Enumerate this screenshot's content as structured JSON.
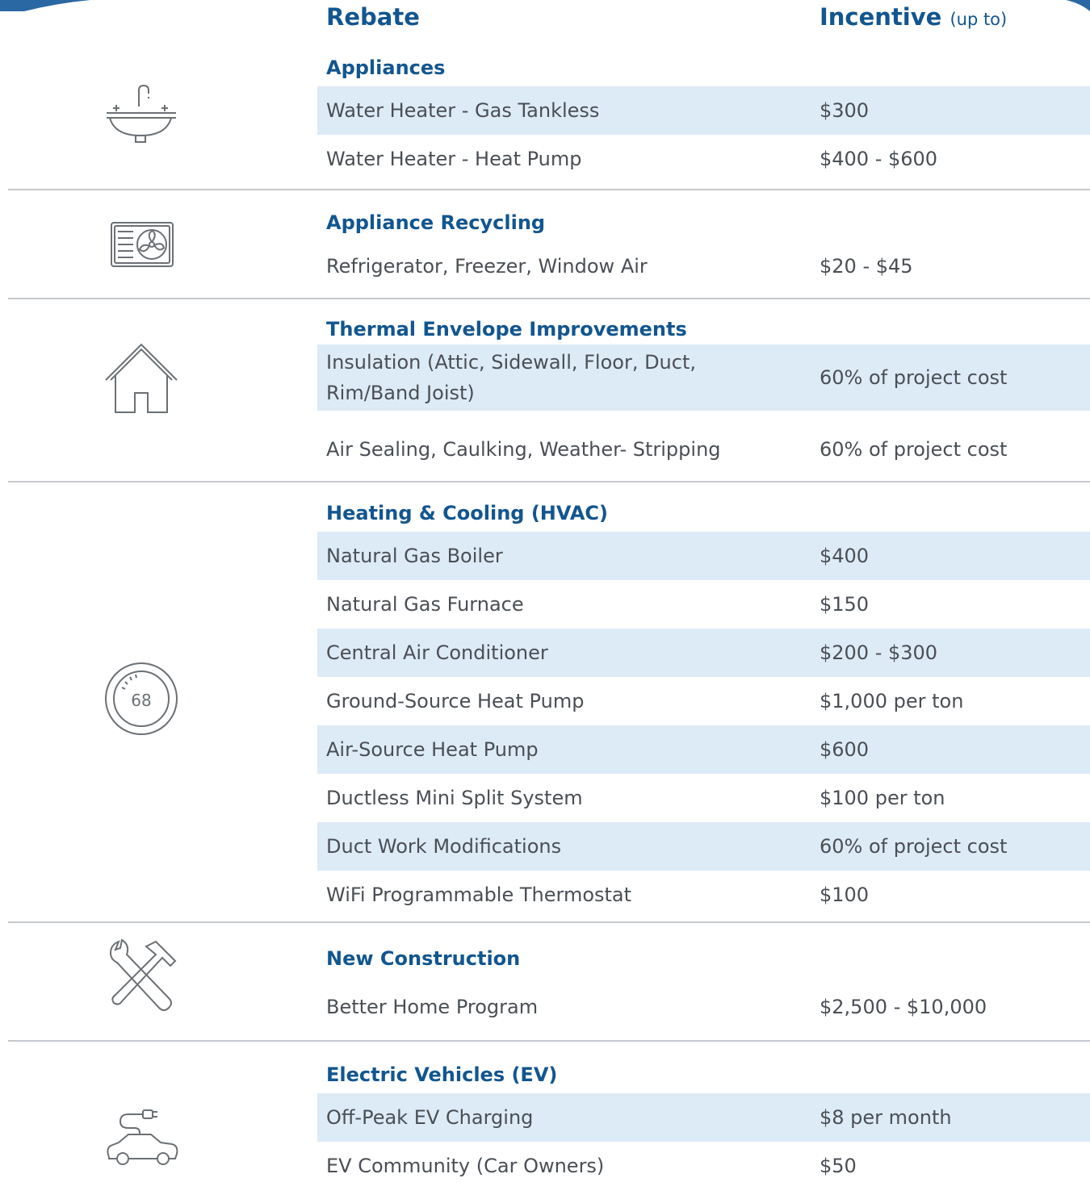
{
  "header": {
    "rebate": "Rebate",
    "incentive": "Incentive",
    "up_to": "(up to)"
  },
  "colors": {
    "accent": "#12568f",
    "row_shade": "#ddebf7",
    "divider": "#c5c9cd",
    "text": "#4a4f55"
  },
  "sections": [
    {
      "title": "Appliances",
      "icon": "sink-icon",
      "rows": [
        {
          "name": "Water Heater - Gas Tankless",
          "value": "$300"
        },
        {
          "name": "Water Heater - Heat Pump",
          "value": "$400 - $600"
        }
      ]
    },
    {
      "title": "Appliance Recycling",
      "icon": "air-conditioner-unit-icon",
      "rows": [
        {
          "name": "Refrigerator, Freezer, Window Air",
          "value": "$20 - $45"
        }
      ]
    },
    {
      "title": "Thermal Envelope Improvements",
      "icon": "house-icon",
      "rows": [
        {
          "name": "Insulation (Attic, Sidewall, Floor, Duct, Rim/Band Joist)",
          "value": "60% of project cost"
        },
        {
          "name": "Air Sealing, Caulking, Weather- Stripping",
          "value": "60% of project cost"
        }
      ]
    },
    {
      "title": "Heating & Cooling (HVAC)",
      "icon": "thermostat-icon",
      "icon_text": "68",
      "rows": [
        {
          "name": "Natural Gas Boiler",
          "value": "$400"
        },
        {
          "name": "Natural Gas Furnace",
          "value": "$150"
        },
        {
          "name": "Central Air Conditioner",
          "value": "$200 - $300"
        },
        {
          "name": "Ground-Source Heat Pump",
          "value": "$1,000 per ton"
        },
        {
          "name": "Air-Source Heat Pump",
          "value": "$600"
        },
        {
          "name": "Ductless Mini Split System",
          "value": "$100 per ton"
        },
        {
          "name": "Duct Work Modifications",
          "value": "60% of project cost"
        },
        {
          "name": "WiFi Programmable Thermostat",
          "value": "$100"
        }
      ]
    },
    {
      "title": "New Construction",
      "icon": "tools-icon",
      "rows": [
        {
          "name": "Better Home Program",
          "value": "$2,500 - $10,000"
        }
      ]
    },
    {
      "title": "Electric Vehicles (EV)",
      "icon": "electric-car-icon",
      "rows": [
        {
          "name": "Off-Peak EV Charging",
          "value": "$8 per month"
        },
        {
          "name": "EV Community (Car Owners)",
          "value": "$50"
        }
      ]
    }
  ]
}
